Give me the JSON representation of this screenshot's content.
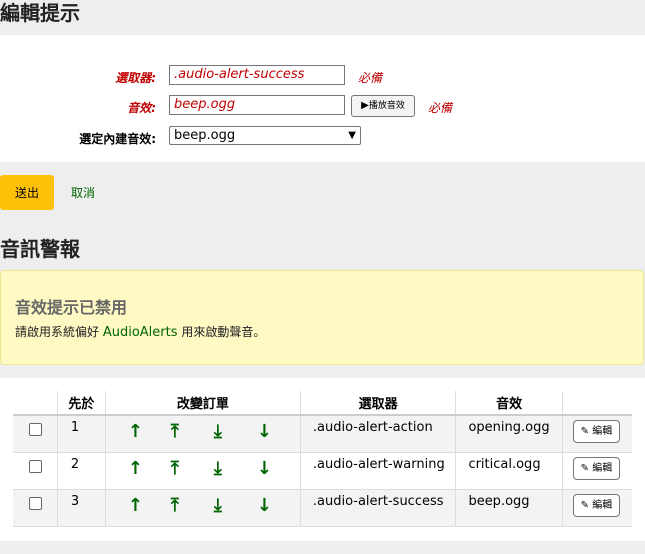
{
  "edit_section": {
    "title": "編輯提示",
    "selector_label": "選取器:",
    "selector_value": ".audio-alert-success",
    "sound_label": "音效:",
    "sound_value": "beep.ogg",
    "play_label": "播放音效",
    "required_text": "必備",
    "builtin_label": "選定內建音效:",
    "builtin_selected": "beep.ogg"
  },
  "actions": {
    "submit_label": "送出",
    "cancel_label": "取消"
  },
  "audio_section": {
    "title": "音訊警報",
    "alert_title": "音效提示已禁用",
    "alert_msg_pre": "請啟用系統偏好 ",
    "alert_link": "AudioAlerts",
    "alert_msg_post": " 用來啟動聲音。"
  },
  "table": {
    "headers": [
      "",
      "先於",
      "改變訂單",
      "選取器",
      "音效",
      ""
    ],
    "arrows": {
      "up": "↑",
      "top": "⤒",
      "bottom": "⤓",
      "down": "↓"
    },
    "edit_label": "編輯",
    "rows": [
      {
        "precedence": "1",
        "selector": ".audio-alert-action",
        "sound": "opening.ogg"
      },
      {
        "precedence": "2",
        "selector": ".audio-alert-warning",
        "sound": "critical.ogg"
      },
      {
        "precedence": "3",
        "selector": ".audio-alert-success",
        "sound": "beep.ogg"
      }
    ]
  },
  "colors": {
    "required_red": "#c00000",
    "link_green": "#006400",
    "submit_yellow": "#ffc107",
    "alert_bg": "#fff9c4"
  },
  "icons": {
    "play": "play-icon",
    "edit": "pencil-icon"
  }
}
